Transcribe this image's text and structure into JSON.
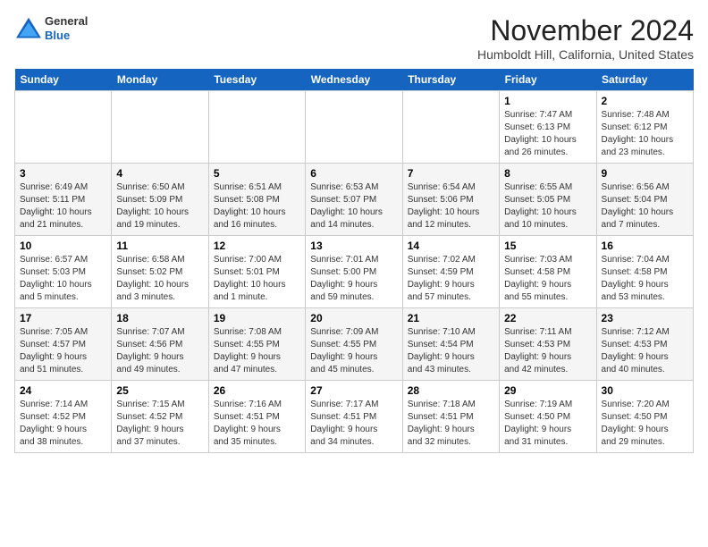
{
  "header": {
    "logo_line1": "General",
    "logo_line2": "Blue",
    "month_title": "November 2024",
    "location": "Humboldt Hill, California, United States"
  },
  "weekdays": [
    "Sunday",
    "Monday",
    "Tuesday",
    "Wednesday",
    "Thursday",
    "Friday",
    "Saturday"
  ],
  "weeks": [
    [
      {
        "day": "",
        "info": ""
      },
      {
        "day": "",
        "info": ""
      },
      {
        "day": "",
        "info": ""
      },
      {
        "day": "",
        "info": ""
      },
      {
        "day": "",
        "info": ""
      },
      {
        "day": "1",
        "info": "Sunrise: 7:47 AM\nSunset: 6:13 PM\nDaylight: 10 hours\nand 26 minutes."
      },
      {
        "day": "2",
        "info": "Sunrise: 7:48 AM\nSunset: 6:12 PM\nDaylight: 10 hours\nand 23 minutes."
      }
    ],
    [
      {
        "day": "3",
        "info": "Sunrise: 6:49 AM\nSunset: 5:11 PM\nDaylight: 10 hours\nand 21 minutes."
      },
      {
        "day": "4",
        "info": "Sunrise: 6:50 AM\nSunset: 5:09 PM\nDaylight: 10 hours\nand 19 minutes."
      },
      {
        "day": "5",
        "info": "Sunrise: 6:51 AM\nSunset: 5:08 PM\nDaylight: 10 hours\nand 16 minutes."
      },
      {
        "day": "6",
        "info": "Sunrise: 6:53 AM\nSunset: 5:07 PM\nDaylight: 10 hours\nand 14 minutes."
      },
      {
        "day": "7",
        "info": "Sunrise: 6:54 AM\nSunset: 5:06 PM\nDaylight: 10 hours\nand 12 minutes."
      },
      {
        "day": "8",
        "info": "Sunrise: 6:55 AM\nSunset: 5:05 PM\nDaylight: 10 hours\nand 10 minutes."
      },
      {
        "day": "9",
        "info": "Sunrise: 6:56 AM\nSunset: 5:04 PM\nDaylight: 10 hours\nand 7 minutes."
      }
    ],
    [
      {
        "day": "10",
        "info": "Sunrise: 6:57 AM\nSunset: 5:03 PM\nDaylight: 10 hours\nand 5 minutes."
      },
      {
        "day": "11",
        "info": "Sunrise: 6:58 AM\nSunset: 5:02 PM\nDaylight: 10 hours\nand 3 minutes."
      },
      {
        "day": "12",
        "info": "Sunrise: 7:00 AM\nSunset: 5:01 PM\nDaylight: 10 hours\nand 1 minute."
      },
      {
        "day": "13",
        "info": "Sunrise: 7:01 AM\nSunset: 5:00 PM\nDaylight: 9 hours\nand 59 minutes."
      },
      {
        "day": "14",
        "info": "Sunrise: 7:02 AM\nSunset: 4:59 PM\nDaylight: 9 hours\nand 57 minutes."
      },
      {
        "day": "15",
        "info": "Sunrise: 7:03 AM\nSunset: 4:58 PM\nDaylight: 9 hours\nand 55 minutes."
      },
      {
        "day": "16",
        "info": "Sunrise: 7:04 AM\nSunset: 4:58 PM\nDaylight: 9 hours\nand 53 minutes."
      }
    ],
    [
      {
        "day": "17",
        "info": "Sunrise: 7:05 AM\nSunset: 4:57 PM\nDaylight: 9 hours\nand 51 minutes."
      },
      {
        "day": "18",
        "info": "Sunrise: 7:07 AM\nSunset: 4:56 PM\nDaylight: 9 hours\nand 49 minutes."
      },
      {
        "day": "19",
        "info": "Sunrise: 7:08 AM\nSunset: 4:55 PM\nDaylight: 9 hours\nand 47 minutes."
      },
      {
        "day": "20",
        "info": "Sunrise: 7:09 AM\nSunset: 4:55 PM\nDaylight: 9 hours\nand 45 minutes."
      },
      {
        "day": "21",
        "info": "Sunrise: 7:10 AM\nSunset: 4:54 PM\nDaylight: 9 hours\nand 43 minutes."
      },
      {
        "day": "22",
        "info": "Sunrise: 7:11 AM\nSunset: 4:53 PM\nDaylight: 9 hours\nand 42 minutes."
      },
      {
        "day": "23",
        "info": "Sunrise: 7:12 AM\nSunset: 4:53 PM\nDaylight: 9 hours\nand 40 minutes."
      }
    ],
    [
      {
        "day": "24",
        "info": "Sunrise: 7:14 AM\nSunset: 4:52 PM\nDaylight: 9 hours\nand 38 minutes."
      },
      {
        "day": "25",
        "info": "Sunrise: 7:15 AM\nSunset: 4:52 PM\nDaylight: 9 hours\nand 37 minutes."
      },
      {
        "day": "26",
        "info": "Sunrise: 7:16 AM\nSunset: 4:51 PM\nDaylight: 9 hours\nand 35 minutes."
      },
      {
        "day": "27",
        "info": "Sunrise: 7:17 AM\nSunset: 4:51 PM\nDaylight: 9 hours\nand 34 minutes."
      },
      {
        "day": "28",
        "info": "Sunrise: 7:18 AM\nSunset: 4:51 PM\nDaylight: 9 hours\nand 32 minutes."
      },
      {
        "day": "29",
        "info": "Sunrise: 7:19 AM\nSunset: 4:50 PM\nDaylight: 9 hours\nand 31 minutes."
      },
      {
        "day": "30",
        "info": "Sunrise: 7:20 AM\nSunset: 4:50 PM\nDaylight: 9 hours\nand 29 minutes."
      }
    ]
  ]
}
